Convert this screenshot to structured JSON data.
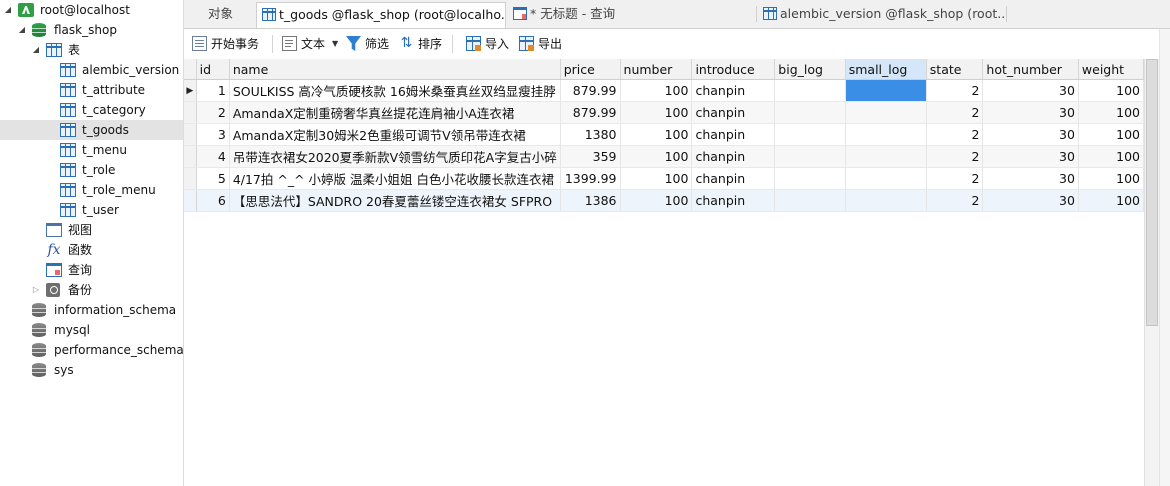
{
  "nav": {
    "connection": "root@localhost",
    "database": "flask_shop",
    "tables_group": "表",
    "tables": [
      "alembic_version",
      "t_attribute",
      "t_category",
      "t_goods",
      "t_menu",
      "t_role",
      "t_role_menu",
      "t_user"
    ],
    "selected_table": "t_goods",
    "views": "视图",
    "functions": "函数",
    "queries": "查询",
    "backups": "备份",
    "other_databases": [
      "information_schema",
      "mysql",
      "performance_schema",
      "sys"
    ]
  },
  "tabs": {
    "objects": "对象",
    "active": "t_goods @flask_shop (root@localho...",
    "query": "* 无标题 - 查询",
    "other": "alembic_version @flask_shop (root..."
  },
  "toolbar": {
    "begin_transaction": "开始事务",
    "text": "文本",
    "filter": "筛选",
    "sort": "排序",
    "import": "导入",
    "export": "导出"
  },
  "grid": {
    "columns": [
      "id",
      "name",
      "price",
      "number",
      "introduce",
      "big_log",
      "small_log",
      "state",
      "hot_number",
      "weight"
    ],
    "rows": [
      {
        "id": "1",
        "name": "SOULKISS 高冷气质硬核款 16姆米桑蚕真丝双绉显瘦挂脖",
        "price": "879.99",
        "number": "100",
        "introduce": "chanpin",
        "big_log": "",
        "small_log": "",
        "state": "2",
        "hot_number": "30",
        "weight": "100"
      },
      {
        "id": "2",
        "name": "AmandaX定制重磅奢华真丝提花连肩袖小A连衣裙",
        "price": "879.99",
        "number": "100",
        "introduce": "chanpin",
        "big_log": "",
        "small_log": "",
        "state": "2",
        "hot_number": "30",
        "weight": "100"
      },
      {
        "id": "3",
        "name": "AmandaX定制30姆米2色重缎可调节V领吊带连衣裙",
        "price": "1380",
        "number": "100",
        "introduce": "chanpin",
        "big_log": "",
        "small_log": "",
        "state": "2",
        "hot_number": "30",
        "weight": "100"
      },
      {
        "id": "4",
        "name": "吊带连衣裙女2020夏季新款V领雪纺气质印花A字复古小碎",
        "price": "359",
        "number": "100",
        "introduce": "chanpin",
        "big_log": "",
        "small_log": "",
        "state": "2",
        "hot_number": "30",
        "weight": "100"
      },
      {
        "id": "5",
        "name": "4/17拍 ^_^ 小婷版 温柔小姐姐 白色小花收腰长款连衣裙",
        "price": "1399.99",
        "number": "100",
        "introduce": "chanpin",
        "big_log": "",
        "small_log": "",
        "state": "2",
        "hot_number": "30",
        "weight": "100"
      },
      {
        "id": "6",
        "name": "【思思法代】SANDRO 20春夏蕾丝镂空连衣裙女 SFPRO",
        "price": "1386",
        "number": "100",
        "introduce": "chanpin",
        "big_log": "",
        "small_log": "",
        "state": "2",
        "hot_number": "30",
        "weight": "100"
      }
    ]
  },
  "colors": {
    "selected_cell": "#3b8ee6",
    "highlight_header": "#d4e6f7",
    "db_green": "#2fa34a",
    "table_blue": "#2d6fb5"
  }
}
